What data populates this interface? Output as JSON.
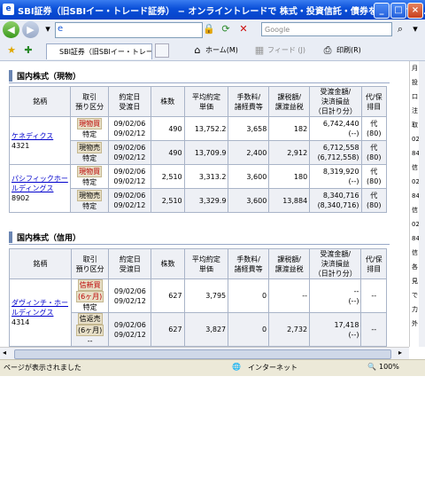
{
  "window": {
    "title": "SBI証券（旧SBIイー・トレード証券） − オンライントレードで 株式・投資信託・債券を − ‐ Win..."
  },
  "toolbar": {
    "search_placeholder": "Google",
    "tab_title": "SBI証券（旧SBIイー・トレー...",
    "home_label": "ホーム(M)",
    "feed_label": "フィード (J)",
    "print_label": "印刷(R)"
  },
  "genbutsu": {
    "section_title": "国内株式（現物）",
    "headers": [
      "銘柄",
      "取引\n預り区分",
      "約定日\n受渡日",
      "株数",
      "平均約定\n単価",
      "手数料/\n諸経費等",
      "課税額/\n譲渡益税",
      "受渡金額/\n決済損益\n（日計り分）",
      "代/保\n排目"
    ],
    "rows": [
      {
        "name": "ケネディクス",
        "code": "4321",
        "trade": "現物買",
        "type": "特定",
        "dates": "09/02/06\n09/02/12",
        "shares": "490",
        "price": "13,752.2",
        "fee": "3,658",
        "tax": "182",
        "amount": "6,742,440\n(--)",
        "flag": "代\n(80)"
      },
      {
        "name": "",
        "code": "",
        "trade": "現物売",
        "type": "特定",
        "dates": "09/02/06\n09/02/12",
        "shares": "490",
        "price": "13,709.9",
        "fee": "2,400",
        "tax": "2,912",
        "amount": "6,712,558\n(6,712,558)",
        "flag": "代\n(80)"
      },
      {
        "name": "パシフィックホールディングス",
        "code": "8902",
        "trade": "現物買",
        "type": "特定",
        "dates": "09/02/06\n09/02/12",
        "shares": "2,510",
        "price": "3,313.2",
        "fee": "3,600",
        "tax": "180",
        "amount": "8,319,920\n(--)",
        "flag": "代\n(80)"
      },
      {
        "name": "",
        "code": "",
        "trade": "現物売",
        "type": "特定",
        "dates": "09/02/06\n09/02/12",
        "shares": "2,510",
        "price": "3,329.9",
        "fee": "3,600",
        "tax": "13,884",
        "amount": "8,340,716\n(8,340,716)",
        "flag": "代\n(80)"
      }
    ]
  },
  "shinyo": {
    "section_title": "国内株式（信用）",
    "headers": [
      "銘柄",
      "取引\n預り区分",
      "約定日\n受渡日",
      "株数",
      "平均約定\n単価",
      "手数料/\n諸経費等",
      "課税額/\n譲渡益税",
      "受渡金額/\n決済損益\n（日計り分）",
      "代/保\n排目"
    ],
    "rows": [
      {
        "name": "ダヴィンチ・ホールディングス",
        "code": "4314",
        "trade": "信新買",
        "term": "(6ヶ月)",
        "type": "特定",
        "dates": "09/02/06\n09/02/12",
        "shares": "627",
        "price": "3,795",
        "fee": "0",
        "tax": "--",
        "amount": "--\n(--)",
        "flag": "--"
      },
      {
        "name": "",
        "code": "",
        "trade": "信返売",
        "term": "(6ヶ月)",
        "type": "--",
        "dates": "09/02/06\n09/02/12",
        "shares": "627",
        "price": "3,827",
        "fee": "0",
        "tax": "2,732",
        "amount": "17,418\n(--)",
        "flag": "--"
      }
    ]
  },
  "rightpane": {
    "texts": [
      "月",
      "投",
      "口",
      "注",
      "取",
      "02",
      "84",
      "信",
      "02",
      "84",
      "信",
      "02",
      "84",
      "信",
      "各",
      "見",
      "で",
      "力",
      "外"
    ]
  },
  "status": {
    "left": "ページが表示されました",
    "zone": "インターネット",
    "zoom": "100%"
  }
}
